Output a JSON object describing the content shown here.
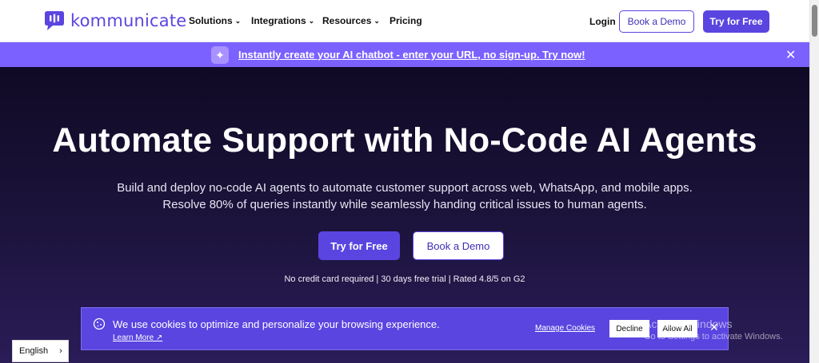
{
  "header": {
    "logo_text": "kommunicate",
    "nav": [
      {
        "label": "Solutions",
        "has_dropdown": true
      },
      {
        "label": "Integrations",
        "has_dropdown": true
      },
      {
        "label": "Resources",
        "has_dropdown": true
      },
      {
        "label": "Pricing",
        "has_dropdown": false
      }
    ],
    "login_label": "Login",
    "demo_label": "Book a Demo",
    "try_label": "Try for Free"
  },
  "banner": {
    "text": "Instantly create your AI chatbot - enter your URL, no sign-up. Try now!",
    "icon": "sparkle-icon",
    "close_icon": "close-icon"
  },
  "hero": {
    "title": "Automate Support with No-Code AI Agents",
    "subtitle_line1": "Build and deploy no-code AI agents to automate customer support across web, WhatsApp, and mobile apps.",
    "subtitle_line2": "Resolve 80% of queries instantly while seamlessly handing critical issues to human agents.",
    "try_label": "Try for Free",
    "demo_label": "Book a Demo",
    "note": "No credit card required | 30 days free trial | Rated 4.8/5 on G2"
  },
  "cookie": {
    "text": "We use cookies to optimize and personalize your browsing experience.",
    "learn_more": "Learn More ↗",
    "manage_label": "Manage Cookies",
    "decline_label": "Decline",
    "allow_label": "Allow All"
  },
  "watermark": {
    "title": "Activate Windows",
    "subtitle": "Go to Settings to activate Windows."
  },
  "language": {
    "selected": "English"
  },
  "colors": {
    "brand": "#5b45e0",
    "banner": "#7b61ff",
    "hero_bg": "#1a1238"
  }
}
